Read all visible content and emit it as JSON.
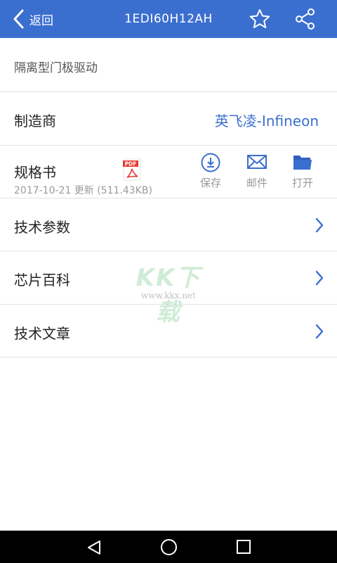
{
  "header": {
    "back_label": "返回",
    "title": "1EDI60H12AH"
  },
  "description": "隔离型门极驱动",
  "manufacturer": {
    "label": "制造商",
    "value": "英飞凌-Infineon"
  },
  "spec": {
    "label": "规格书",
    "pdf_badge": "PDF",
    "meta": "2017-10-21 更新  (511.43KB)",
    "actions": [
      {
        "label": "保存",
        "icon": "download-icon"
      },
      {
        "label": "邮件",
        "icon": "mail-icon"
      },
      {
        "label": "打开",
        "icon": "folder-icon"
      }
    ]
  },
  "nav_rows": [
    {
      "label": "技术参数"
    },
    {
      "label": "芯片百科"
    },
    {
      "label": "技术文章"
    }
  ],
  "watermark": {
    "brand": "KK下载",
    "url": "www.kkx.net"
  },
  "colors": {
    "accent": "#3b6fcf",
    "pdf_red": "#e23b2e",
    "system_bar": "#000000"
  }
}
